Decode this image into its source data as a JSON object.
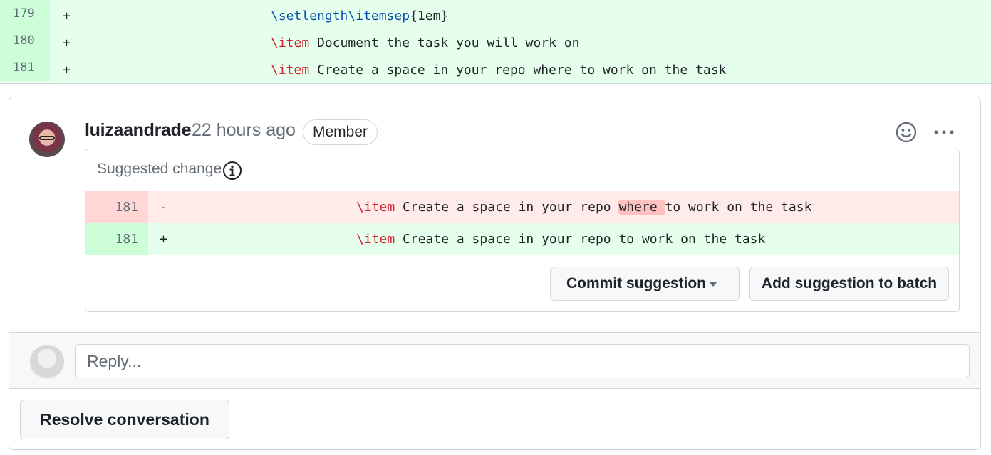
{
  "diff_top": {
    "lines": [
      {
        "num": "179",
        "sign": "+",
        "code_prefix": "",
        "code_kw": "\\setlength\\itemsep",
        "code_rest": "{1em}"
      },
      {
        "num": "180",
        "sign": "+",
        "code_kw": "\\item",
        "code_rest": " Document the task you will work on"
      },
      {
        "num": "181",
        "sign": "+",
        "code_kw": "\\item",
        "code_rest": " Create a space in your repo where to work on the task"
      }
    ]
  },
  "comment": {
    "author": "luizaandrade",
    "time_ago": "22 hours ago",
    "badge": "Member",
    "suggested_change_label": "Suggested change",
    "deleted_line": {
      "num": "181",
      "sign": "-",
      "kw": "\\item",
      "before": " Create a space in your repo ",
      "highlight": "where ",
      "after": "to work on the task"
    },
    "added_line": {
      "num": "181",
      "sign": "+",
      "kw": "\\item",
      "rest": " Create a space in your repo to work on the task"
    },
    "commit_button": "Commit suggestion",
    "batch_button": "Add suggestion to batch"
  },
  "reply": {
    "placeholder": "Reply..."
  },
  "resolve_button": "Resolve conversation",
  "colors": {
    "add_bg": "#e6ffec",
    "add_num_bg": "#ccffd8",
    "del_bg": "#ffebe9",
    "del_num_bg": "#ffd7d5",
    "keyword_red": "#cf222e",
    "keyword_blue": "#0550ae"
  },
  "icons": {
    "emoji": "smiley-icon",
    "more": "kebab-horizontal-icon",
    "info": "info-icon",
    "caret": "triangle-down-icon"
  }
}
